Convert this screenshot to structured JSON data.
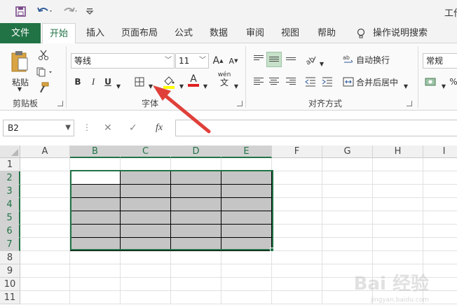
{
  "window": {
    "title": "工作"
  },
  "qat": {
    "save_icon": "save-icon",
    "undo_icon": "undo-icon",
    "redo_icon": "redo-icon",
    "customize_icon": "customize-icon"
  },
  "tabs": [
    {
      "label": "文件"
    },
    {
      "label": "开始"
    },
    {
      "label": "插入"
    },
    {
      "label": "页面布局"
    },
    {
      "label": "公式"
    },
    {
      "label": "数据"
    },
    {
      "label": "审阅"
    },
    {
      "label": "视图"
    },
    {
      "label": "帮助"
    },
    {
      "label": "操作说明搜索"
    }
  ],
  "ribbon": {
    "clipboard": {
      "paste_label": "粘贴",
      "group_label": "剪贴板"
    },
    "font": {
      "font_name": "等线",
      "font_size": "11",
      "grow": "A",
      "shrink": "A",
      "bold": "B",
      "italic": "I",
      "underline": "U",
      "font_color_glyph": "A",
      "phonetic_glyph": "wén",
      "group_label": "字体"
    },
    "alignment": {
      "wrap_text": "自动换行",
      "merge_center": "合并后居中",
      "group_label": "对齐方式"
    },
    "number": {
      "format": "常规"
    }
  },
  "formula_bar": {
    "name_box": "B2",
    "fx": "fx",
    "value": ""
  },
  "grid": {
    "columns": [
      "A",
      "B",
      "C",
      "D",
      "E",
      "F",
      "G",
      "H",
      "I"
    ],
    "rows": [
      "1",
      "2",
      "3",
      "4",
      "5",
      "6",
      "7",
      "8",
      "9",
      "10",
      "11"
    ],
    "selected_range": "B2:E7",
    "active_cell": "B2"
  },
  "watermark": {
    "text": "Bai 经验",
    "sub": "jingyan.baidu.com"
  },
  "colors": {
    "accent": "#217346",
    "shaded_fill": "#c5c5c5",
    "arrow": "#e0403a"
  }
}
